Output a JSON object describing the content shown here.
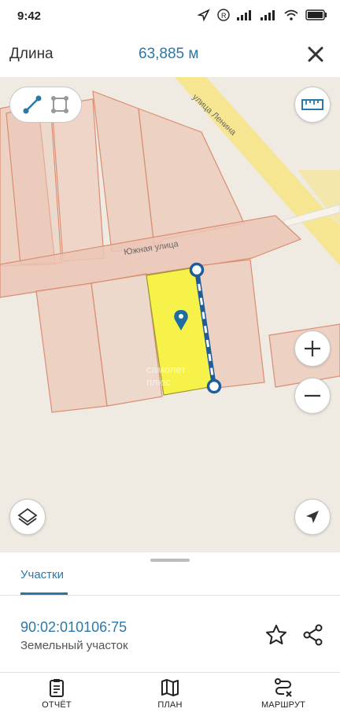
{
  "status_bar": {
    "time": "9:42"
  },
  "header": {
    "title": "Длина",
    "value": "63,885 м"
  },
  "map": {
    "street_south": "Южная улица",
    "street_lenin": "улица Ленина",
    "watermark_1": "самолет",
    "watermark_2": "плюс"
  },
  "sheet": {
    "tab_label": "Участки",
    "parcel_id": "90:02:010106:75",
    "parcel_type": "Земельный участок"
  },
  "nav": {
    "report": "ОТЧЁТ",
    "plan": "ПЛАН",
    "route": "МАРШРУТ"
  },
  "colors": {
    "accent": "#2b78a8",
    "parcel_fill": "#ecc6b5",
    "parcel_stroke": "#d98e73",
    "selected_parcel": "#f7f24a",
    "road_yellow": "#f6e58a"
  }
}
